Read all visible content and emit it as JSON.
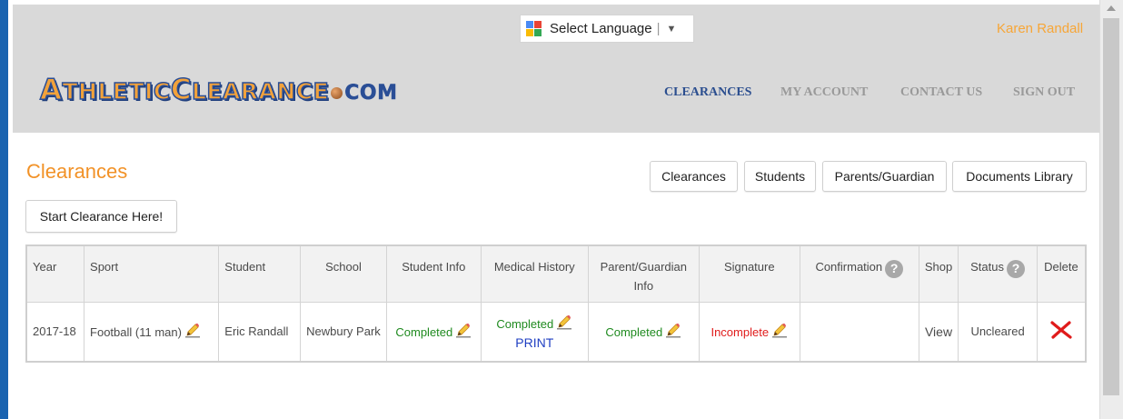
{
  "header": {
    "language_label": "Select Language",
    "user_name": "Karen Randall",
    "logo": {
      "letter1": "A",
      "part1": "THLETIC",
      "letter2": "C",
      "part2": "LEARANCE",
      "dotcom": "COM"
    },
    "nav": [
      {
        "label": "CLEARANCES",
        "active": true
      },
      {
        "label": "MY ACCOUNT",
        "active": false
      },
      {
        "label": "CONTACT US",
        "active": false
      },
      {
        "label": "SIGN OUT",
        "active": false
      }
    ]
  },
  "page": {
    "title": "Clearances",
    "start_button": "Start Clearance Here!",
    "tab_buttons": [
      "Clearances",
      "Students",
      "Parents/Guardian",
      "Documents Library"
    ]
  },
  "table": {
    "columns": [
      "Year",
      "Sport",
      "Student",
      "School",
      "Student Info",
      "Medical History",
      "Parent/Guardian Info",
      "Signature",
      "Confirmation",
      "Shop",
      "Status",
      "Delete"
    ],
    "help_symbol": "?",
    "rows": [
      {
        "year": "2017-18",
        "sport": "Football (11 man)",
        "student": "Eric Randall",
        "school": "Newbury Park",
        "student_info": "Completed",
        "medical_history": "Completed",
        "medical_print": "PRINT",
        "parent_info": "Completed",
        "signature": "Incomplete",
        "confirmation": "",
        "shop": "View",
        "status": "Uncleared"
      }
    ]
  },
  "colors": {
    "accent_orange": "#f29227",
    "nav_active": "#2b4e8f",
    "completed": "#1f8a1f",
    "incomplete": "#e01b1b",
    "link": "#1f3fc2"
  },
  "icons": [
    "google-translate-icon",
    "dropdown-arrow-icon",
    "pencil-icon",
    "help-icon",
    "delete-x-icon"
  ]
}
